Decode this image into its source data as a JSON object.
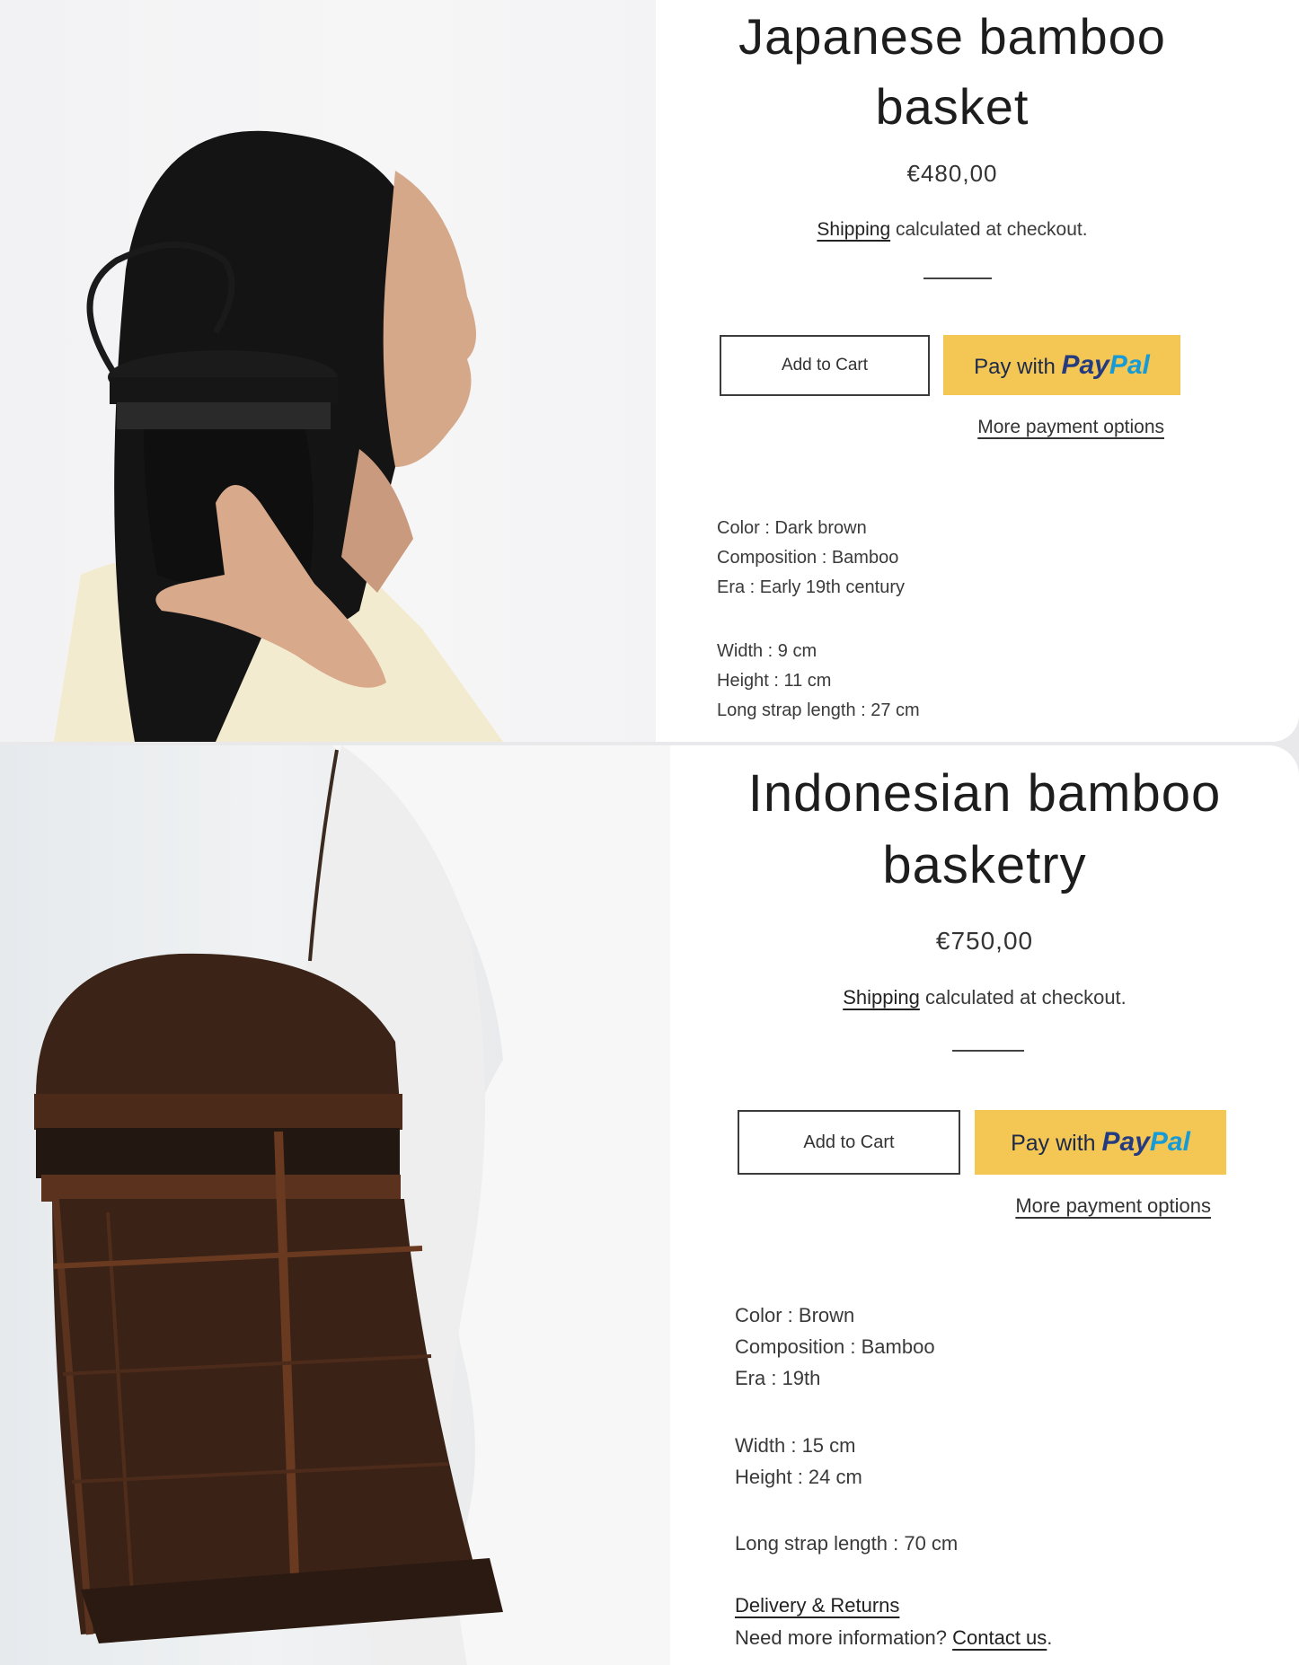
{
  "products": [
    {
      "title_line1": "Japanese bamboo",
      "title_line2": "basket",
      "price": "€480,00",
      "shipping_link": "Shipping",
      "shipping_text": " calculated at checkout.",
      "add_to_cart": "Add to Cart",
      "paypal_prefix": "Pay with ",
      "paypal_pay": "Pay",
      "paypal_pal": "Pal",
      "more_payment_options": "More payment options",
      "specs": {
        "color": "Color : Dark brown",
        "composition": "Composition : Bamboo",
        "era": "Era : Early 19th century",
        "width": "Width : 9 cm",
        "height": "Height : 11 cm",
        "strap": "Long strap length : 27 cm"
      }
    },
    {
      "title_line1": "Indonesian bamboo",
      "title_line2": "basketry",
      "price": "€750,00",
      "shipping_link": "Shipping",
      "shipping_text": " calculated at checkout.",
      "add_to_cart": "Add to Cart",
      "paypal_prefix": "Pay with ",
      "paypal_pay": "Pay",
      "paypal_pal": "Pal",
      "more_payment_options": "More payment options",
      "specs": {
        "color": "Color : Brown",
        "composition": "Composition : Bamboo",
        "era": "Era : 19th",
        "width": "Width : 15 cm",
        "height": "Height : 24 cm",
        "strap": "Long strap length : 70 cm"
      },
      "delivery_returns": "Delivery & Returns",
      "need_info": "Need more information? ",
      "contact_us": "Contact us",
      "period": "."
    }
  ],
  "colors": {
    "paypal_button": "#f4c653",
    "paypal_pay": "#253b80",
    "paypal_pal": "#179bd7",
    "text": "#222222"
  }
}
